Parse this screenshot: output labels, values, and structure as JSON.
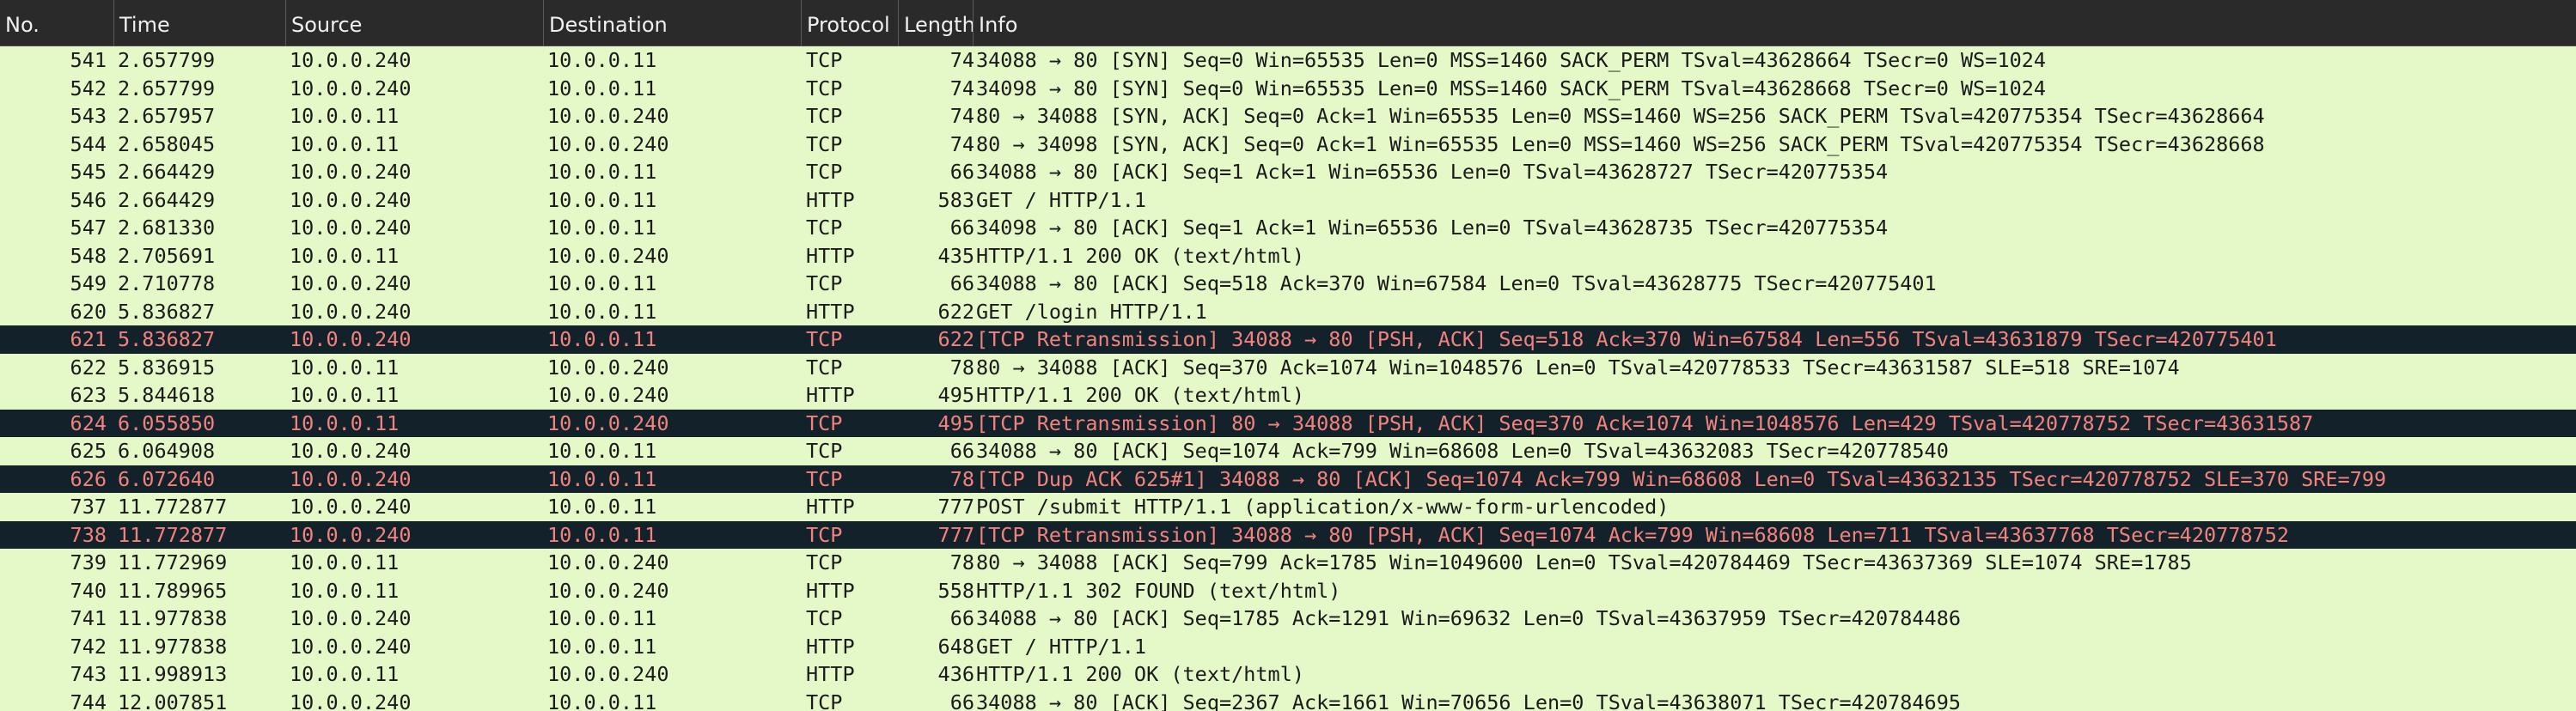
{
  "columns": [
    "No.",
    "Time",
    "Source",
    "Destination",
    "Protocol",
    "Length",
    "Info"
  ],
  "packets": [
    {
      "no": "541",
      "time": "2.657799",
      "src": "10.0.0.240",
      "dst": "10.0.0.11",
      "proto": "TCP",
      "len": "74",
      "info": "34088 → 80 [SYN] Seq=0 Win=65535 Len=0 MSS=1460 SACK_PERM TSval=43628664 TSecr=0 WS=1024",
      "highlight": false
    },
    {
      "no": "542",
      "time": "2.657799",
      "src": "10.0.0.240",
      "dst": "10.0.0.11",
      "proto": "TCP",
      "len": "74",
      "info": "34098 → 80 [SYN] Seq=0 Win=65535 Len=0 MSS=1460 SACK_PERM TSval=43628668 TSecr=0 WS=1024",
      "highlight": false
    },
    {
      "no": "543",
      "time": "2.657957",
      "src": "10.0.0.11",
      "dst": "10.0.0.240",
      "proto": "TCP",
      "len": "74",
      "info": "80 → 34088 [SYN, ACK] Seq=0 Ack=1 Win=65535 Len=0 MSS=1460 WS=256 SACK_PERM TSval=420775354 TSecr=43628664",
      "highlight": false
    },
    {
      "no": "544",
      "time": "2.658045",
      "src": "10.0.0.11",
      "dst": "10.0.0.240",
      "proto": "TCP",
      "len": "74",
      "info": "80 → 34098 [SYN, ACK] Seq=0 Ack=1 Win=65535 Len=0 MSS=1460 WS=256 SACK_PERM TSval=420775354 TSecr=43628668",
      "highlight": false
    },
    {
      "no": "545",
      "time": "2.664429",
      "src": "10.0.0.240",
      "dst": "10.0.0.11",
      "proto": "TCP",
      "len": "66",
      "info": "34088 → 80 [ACK] Seq=1 Ack=1 Win=65536 Len=0 TSval=43628727 TSecr=420775354",
      "highlight": false
    },
    {
      "no": "546",
      "time": "2.664429",
      "src": "10.0.0.240",
      "dst": "10.0.0.11",
      "proto": "HTTP",
      "len": "583",
      "info": "GET / HTTP/1.1",
      "highlight": false
    },
    {
      "no": "547",
      "time": "2.681330",
      "src": "10.0.0.240",
      "dst": "10.0.0.11",
      "proto": "TCP",
      "len": "66",
      "info": "34098 → 80 [ACK] Seq=1 Ack=1 Win=65536 Len=0 TSval=43628735 TSecr=420775354",
      "highlight": false
    },
    {
      "no": "548",
      "time": "2.705691",
      "src": "10.0.0.11",
      "dst": "10.0.0.240",
      "proto": "HTTP",
      "len": "435",
      "info": "HTTP/1.1 200 OK  (text/html)",
      "highlight": false
    },
    {
      "no": "549",
      "time": "2.710778",
      "src": "10.0.0.240",
      "dst": "10.0.0.11",
      "proto": "TCP",
      "len": "66",
      "info": "34088 → 80 [ACK] Seq=518 Ack=370 Win=67584 Len=0 TSval=43628775 TSecr=420775401",
      "highlight": false
    },
    {
      "no": "620",
      "time": "5.836827",
      "src": "10.0.0.240",
      "dst": "10.0.0.11",
      "proto": "HTTP",
      "len": "622",
      "info": "GET /login HTTP/1.1",
      "highlight": false
    },
    {
      "no": "621",
      "time": "5.836827",
      "src": "10.0.0.240",
      "dst": "10.0.0.11",
      "proto": "TCP",
      "len": "622",
      "info": "[TCP Retransmission] 34088 → 80 [PSH, ACK] Seq=518 Ack=370 Win=67584 Len=556 TSval=43631879 TSecr=420775401",
      "highlight": true
    },
    {
      "no": "622",
      "time": "5.836915",
      "src": "10.0.0.11",
      "dst": "10.0.0.240",
      "proto": "TCP",
      "len": "78",
      "info": "80 → 34088 [ACK] Seq=370 Ack=1074 Win=1048576 Len=0 TSval=420778533 TSecr=43631587 SLE=518 SRE=1074",
      "highlight": false
    },
    {
      "no": "623",
      "time": "5.844618",
      "src": "10.0.0.11",
      "dst": "10.0.0.240",
      "proto": "HTTP",
      "len": "495",
      "info": "HTTP/1.1 200 OK  (text/html)",
      "highlight": false
    },
    {
      "no": "624",
      "time": "6.055850",
      "src": "10.0.0.11",
      "dst": "10.0.0.240",
      "proto": "TCP",
      "len": "495",
      "info": "[TCP Retransmission] 80 → 34088 [PSH, ACK] Seq=370 Ack=1074 Win=1048576 Len=429 TSval=420778752 TSecr=43631587",
      "highlight": true
    },
    {
      "no": "625",
      "time": "6.064908",
      "src": "10.0.0.240",
      "dst": "10.0.0.11",
      "proto": "TCP",
      "len": "66",
      "info": "34088 → 80 [ACK] Seq=1074 Ack=799 Win=68608 Len=0 TSval=43632083 TSecr=420778540",
      "highlight": false
    },
    {
      "no": "626",
      "time": "6.072640",
      "src": "10.0.0.240",
      "dst": "10.0.0.11",
      "proto": "TCP",
      "len": "78",
      "info": "[TCP Dup ACK 625#1] 34088 → 80 [ACK] Seq=1074 Ack=799 Win=68608 Len=0 TSval=43632135 TSecr=420778752 SLE=370 SRE=799",
      "highlight": true
    },
    {
      "no": "737",
      "time": "11.772877",
      "src": "10.0.0.240",
      "dst": "10.0.0.11",
      "proto": "HTTP",
      "len": "777",
      "info": "POST /submit HTTP/1.1  (application/x-www-form-urlencoded)",
      "highlight": false
    },
    {
      "no": "738",
      "time": "11.772877",
      "src": "10.0.0.240",
      "dst": "10.0.0.11",
      "proto": "TCP",
      "len": "777",
      "info": "[TCP Retransmission] 34088 → 80 [PSH, ACK] Seq=1074 Ack=799 Win=68608 Len=711 TSval=43637768 TSecr=420778752",
      "highlight": true
    },
    {
      "no": "739",
      "time": "11.772969",
      "src": "10.0.0.11",
      "dst": "10.0.0.240",
      "proto": "TCP",
      "len": "78",
      "info": "80 → 34088 [ACK] Seq=799 Ack=1785 Win=1049600 Len=0 TSval=420784469 TSecr=43637369 SLE=1074 SRE=1785",
      "highlight": false
    },
    {
      "no": "740",
      "time": "11.789965",
      "src": "10.0.0.11",
      "dst": "10.0.0.240",
      "proto": "HTTP",
      "len": "558",
      "info": "HTTP/1.1 302 FOUND  (text/html)",
      "highlight": false
    },
    {
      "no": "741",
      "time": "11.977838",
      "src": "10.0.0.240",
      "dst": "10.0.0.11",
      "proto": "TCP",
      "len": "66",
      "info": "34088 → 80 [ACK] Seq=1785 Ack=1291 Win=69632 Len=0 TSval=43637959 TSecr=420784486",
      "highlight": false
    },
    {
      "no": "742",
      "time": "11.977838",
      "src": "10.0.0.240",
      "dst": "10.0.0.11",
      "proto": "HTTP",
      "len": "648",
      "info": "GET / HTTP/1.1",
      "highlight": false
    },
    {
      "no": "743",
      "time": "11.998913",
      "src": "10.0.0.11",
      "dst": "10.0.0.240",
      "proto": "HTTP",
      "len": "436",
      "info": "HTTP/1.1 200 OK  (text/html)",
      "highlight": false
    },
    {
      "no": "744",
      "time": "12.007851",
      "src": "10.0.0.240",
      "dst": "10.0.0.11",
      "proto": "TCP",
      "len": "66",
      "info": "34088 → 80 [ACK] Seq=2367 Ack=1661 Win=70656 Len=0 TSval=43638071 TSecr=420784695",
      "highlight": false
    }
  ],
  "colors": {
    "header_bg": "#2a2a2a",
    "header_text": "#f0f0f0",
    "row_bg": "#e5f8c8",
    "row_text": "#1a1a1a",
    "highlight_bg": "#13212b",
    "highlight_text": "#f2837c"
  }
}
